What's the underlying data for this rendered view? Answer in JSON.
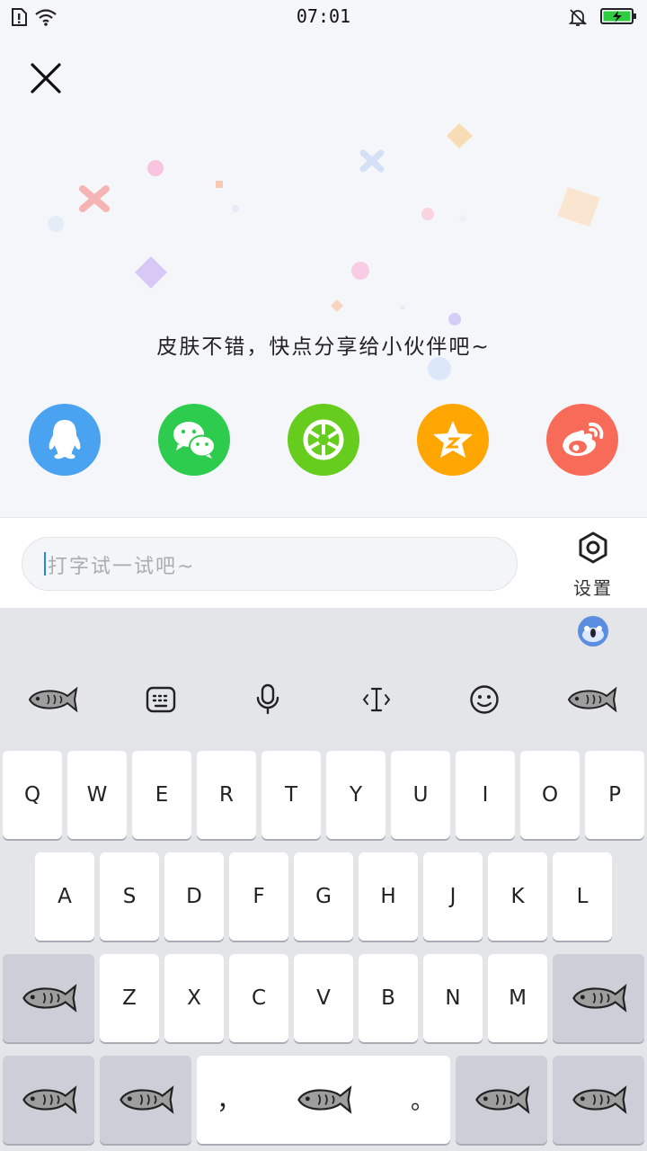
{
  "status_bar": {
    "time": "07:01"
  },
  "share": {
    "message": "皮肤不错，快点分享给小伙伴吧~",
    "targets": [
      {
        "icon": "qq-icon",
        "color": "#4aa3f0"
      },
      {
        "icon": "wechat-icon",
        "color": "#2dcc4f"
      },
      {
        "icon": "moments-icon",
        "color": "#66cc1e"
      },
      {
        "icon": "qzone-icon",
        "color": "#ffa600"
      },
      {
        "icon": "weibo-icon",
        "color": "#f76b58"
      }
    ]
  },
  "input": {
    "placeholder": "打字试一试吧~"
  },
  "settings": {
    "label": "设置"
  },
  "keyboard": {
    "row1": [
      "Q",
      "W",
      "E",
      "R",
      "T",
      "Y",
      "U",
      "I",
      "O",
      "P"
    ],
    "row2": [
      "A",
      "S",
      "D",
      "F",
      "G",
      "H",
      "J",
      "K",
      "L"
    ],
    "row3": [
      "Z",
      "X",
      "C",
      "V",
      "B",
      "N",
      "M"
    ],
    "space_left": "，",
    "space_right": "。",
    "toolbar_icons": [
      "fish-icon",
      "keyboard-icon",
      "microphone-icon",
      "cursor-icon",
      "emoji-icon",
      "fish-icon"
    ]
  },
  "colors": {
    "accent": "#1e88e5",
    "key_bg": "#ffffff",
    "func_key_bg": "#ccced8",
    "keyboard_bg": "#e3e5e9"
  }
}
